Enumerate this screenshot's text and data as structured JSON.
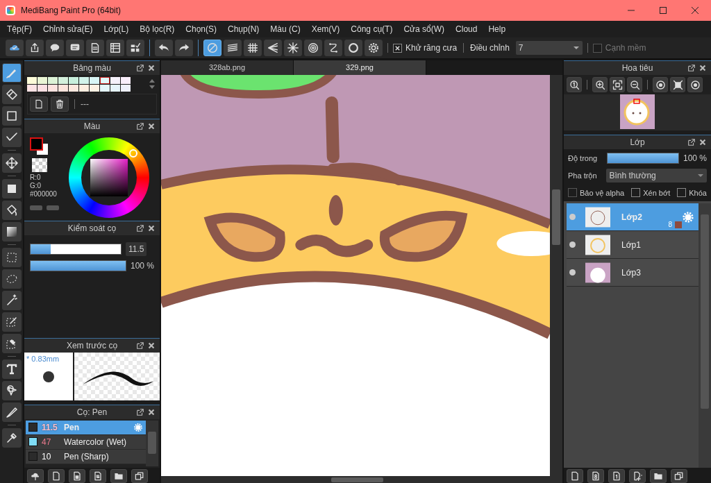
{
  "window": {
    "title": "MediBang Paint Pro (64bit)"
  },
  "menu": [
    "Tệp(F)",
    "Chỉnh sửa(E)",
    "Lớp(L)",
    "Bộ lọc(R)",
    "Chọn(S)",
    "Chụp(N)",
    "Màu (C)",
    "Xem(V)",
    "Công cụ(T)",
    "Cửa sổ(W)",
    "Cloud",
    "Help"
  ],
  "toolbar": {
    "snaps": [
      {
        "selected": true
      },
      {
        "selected": false
      },
      {
        "selected": false
      },
      {
        "selected": false
      },
      {
        "selected": false
      },
      {
        "selected": false
      },
      {
        "selected": false
      },
      {
        "selected": false
      }
    ],
    "antialias": {
      "label": "Khử răng cưa",
      "checked": true
    },
    "correction": {
      "label": "Điều chỉnh",
      "value": "7"
    },
    "soft_edge": {
      "label": "Cạnh mềm",
      "checked": false,
      "disabled": true
    }
  },
  "tools": [
    {
      "selected": true
    },
    {
      "selected": false
    },
    {
      "selected": false
    },
    {
      "selected": false
    },
    {
      "selected": false
    },
    {
      "selected": false
    },
    {
      "selected": false
    },
    {
      "selected": false
    },
    {
      "selected": false
    },
    {
      "selected": false
    },
    {
      "selected": false
    },
    {
      "selected": false
    },
    {
      "selected": false
    },
    {
      "selected": false
    },
    {
      "selected": false
    },
    {
      "selected": false
    },
    {
      "selected": false
    }
  ],
  "palette": {
    "title": "Bảng màu",
    "swatches": [
      {
        "color": "#fdfbd8",
        "selected": false
      },
      {
        "color": "#eaf5d4",
        "selected": false
      },
      {
        "color": "#dcf2d6",
        "selected": false
      },
      {
        "color": "#d4f0dc",
        "selected": false
      },
      {
        "color": "#c8efdc",
        "selected": false
      },
      {
        "color": "#d2f3ea",
        "selected": false
      },
      {
        "color": "#d8f6f6",
        "selected": false
      },
      {
        "color": "#e0f8fb",
        "selected": true
      },
      {
        "color": "#f5f1fb",
        "selected": false
      },
      {
        "color": "#f9eefb",
        "selected": false
      },
      {
        "color": "#fde2e4",
        "selected": false
      },
      {
        "color": "#fcdfe2",
        "selected": false
      },
      {
        "color": "#fde2df",
        "selected": false
      },
      {
        "color": "#fde4dc",
        "selected": false
      },
      {
        "color": "#fde8de",
        "selected": false
      },
      {
        "color": "#fdeee0",
        "selected": false
      },
      {
        "color": "#fdf2e4",
        "selected": false
      },
      {
        "color": "#e4f6fb",
        "selected": false
      },
      {
        "color": "#e6f4fb",
        "selected": false
      },
      {
        "color": "#eef0fb",
        "selected": false
      }
    ],
    "label": "---"
  },
  "color": {
    "title": "Màu",
    "r": "R:0",
    "g": "G:0",
    "hex": "#000000"
  },
  "brush_control": {
    "title": "Kiểm soát cọ",
    "size": {
      "level": 0.22,
      "value": "11.5"
    },
    "opacity": {
      "level": 1,
      "value": "100 %"
    }
  },
  "brush_preview": {
    "title": "Xem trước cọ",
    "size": "* 0.83mm"
  },
  "brushes": {
    "title": "Cọ: Pen",
    "items": [
      {
        "size": "11.5",
        "name": "Pen",
        "color": "#2b2b2b",
        "highlighted": true,
        "selected": true
      },
      {
        "size": "47",
        "name": "Watercolor (Wet)",
        "color": "#7fdcf5",
        "highlighted": true,
        "selected": false
      },
      {
        "size": "10",
        "name": "Pen (Sharp)",
        "color": "#2b2b2b",
        "highlighted": false,
        "selected": false
      }
    ]
  },
  "tabs": [
    {
      "label": "328ab.png",
      "selected": false
    },
    {
      "label": "329.png",
      "selected": true
    }
  ],
  "navigator": {
    "title": "Hoa tiêu"
  },
  "layers": {
    "title": "Lớp",
    "opacity": {
      "label": "Độ trong",
      "level": 1,
      "value": "100 %"
    },
    "blend": {
      "label": "Pha trộn",
      "value": "Bình thường"
    },
    "options": [
      {
        "label": "Bảo vệ alpha",
        "checked": false,
        "disabled": true
      },
      {
        "label": "Xén bớt",
        "checked": false,
        "disabled": false
      },
      {
        "label": "Khóa",
        "checked": false,
        "disabled": false
      }
    ],
    "items": [
      {
        "name": "Lớp2",
        "selected": true,
        "badge": "8",
        "color": "#8e4b3e"
      },
      {
        "name": "Lớp1",
        "selected": false
      },
      {
        "name": "Lớp3",
        "selected": false
      }
    ]
  }
}
